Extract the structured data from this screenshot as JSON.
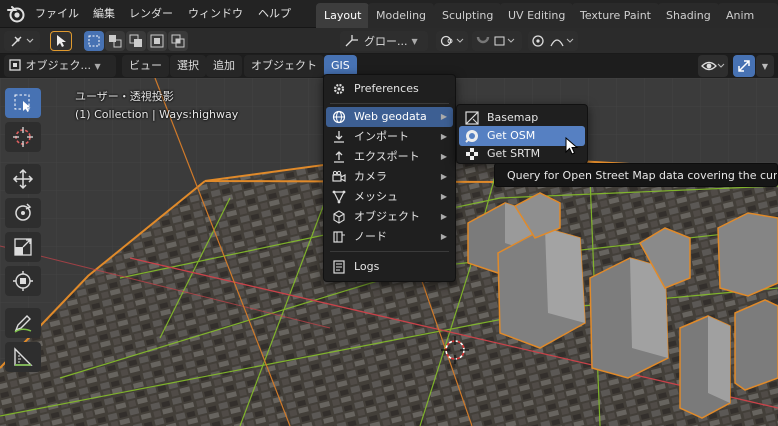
{
  "topbar": {
    "menus": [
      "ファイル",
      "編集",
      "レンダー",
      "ウィンドウ",
      "ヘルプ"
    ],
    "workspaces": [
      "Layout",
      "Modeling",
      "Sculpting",
      "UV Editing",
      "Texture Paint",
      "Shading",
      "Anim"
    ],
    "active_workspace": "Layout"
  },
  "tool_header": {
    "orientation": "グロー...",
    "proportional_label": "⊞"
  },
  "viewport_header": {
    "mode": "オブジェク...",
    "menus": [
      "ビュー",
      "選択",
      "追加",
      "オブジェクト",
      "GIS"
    ],
    "active_menu": "GIS"
  },
  "viewport": {
    "view_name": "ユーザー・透視投影",
    "collection_info": "(1) Collection | Ways:highway"
  },
  "gis_menu": {
    "items": [
      {
        "label": "Preferences",
        "icon": "gear-icon",
        "submenu": false
      },
      {
        "label": "Web geodata",
        "icon": "globe-icon",
        "submenu": true
      },
      {
        "label": "インポート",
        "icon": "import-icon",
        "submenu": true
      },
      {
        "label": "エクスポート",
        "icon": "export-icon",
        "submenu": true
      },
      {
        "label": "カメラ",
        "icon": "camera-icon",
        "submenu": true
      },
      {
        "label": "メッシュ",
        "icon": "mesh-icon",
        "submenu": true
      },
      {
        "label": "オブジェクト",
        "icon": "cube-icon",
        "submenu": true
      },
      {
        "label": "ノード",
        "icon": "node-icon",
        "submenu": true
      },
      {
        "label": "Logs",
        "icon": "logs-icon",
        "submenu": false
      }
    ]
  },
  "web_geodata_menu": {
    "items": [
      {
        "label": "Basemap",
        "icon": "basemap-icon"
      },
      {
        "label": "Get OSM",
        "icon": "osm-icon"
      },
      {
        "label": "Get SRTM",
        "icon": "srtm-icon"
      }
    ]
  },
  "tooltip": {
    "text": "Query for Open Street Map data covering the current vi"
  },
  "colors": {
    "accent": "#4772b3",
    "menu_bg": "#1f1f1f",
    "selection_outline": "#e08a2a"
  }
}
